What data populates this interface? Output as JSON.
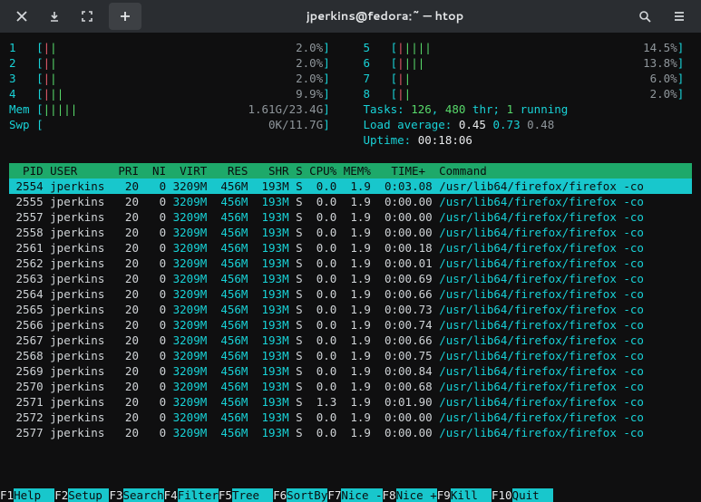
{
  "window": {
    "title": "jperkins@fedora:~ — htop"
  },
  "cpu_meters_left": [
    {
      "n": "1",
      "bars": "||",
      "pct": "2.0%"
    },
    {
      "n": "2",
      "bars": "||",
      "pct": "2.0%"
    },
    {
      "n": "3",
      "bars": "||",
      "pct": "2.0%"
    },
    {
      "n": "4",
      "bars": "|||",
      "pct": "9.9%"
    }
  ],
  "cpu_meters_right": [
    {
      "n": "5",
      "bars": "|||||",
      "pct": "14.5%"
    },
    {
      "n": "6",
      "bars": "||||",
      "pct": "13.8%"
    },
    {
      "n": "7",
      "bars": "||",
      "pct": "6.0%"
    },
    {
      "n": "8",
      "bars": "||",
      "pct": "2.0%"
    }
  ],
  "mem": {
    "label": "Mem",
    "bars": "|||||",
    "text": "1.61G/23.4G"
  },
  "swp": {
    "label": "Swp",
    "bars": "",
    "text": "0K/11.7G"
  },
  "tasks": {
    "prefix": "Tasks:",
    "procs": "126",
    "sep1": ",",
    "thr": "480",
    "thr_lbl": "thr;",
    "running": "1",
    "running_lbl": "running"
  },
  "load": {
    "prefix": "Load average:",
    "a": "0.45",
    "b": "0.73",
    "c": "0.48"
  },
  "uptime": {
    "prefix": "Uptime:",
    "val": "00:18:06"
  },
  "header": "  PID USER      PRI  NI  VIRT   RES   SHR S CPU% MEM%   TIME+  Command",
  "processes": [
    {
      "pid": "2554",
      "user": "jperkins",
      "pri": "20",
      "ni": "0",
      "virt": "3209M",
      "res": "456M",
      "shr": "193M",
      "s": "S",
      "cpu": "0.0",
      "mem": "1.9",
      "time": "0:03.08",
      "cmd": "/usr/lib64/firefox/firefox -co",
      "sel": true
    },
    {
      "pid": "2555",
      "user": "jperkins",
      "pri": "20",
      "ni": "0",
      "virt": "3209M",
      "res": "456M",
      "shr": "193M",
      "s": "S",
      "cpu": "0.0",
      "mem": "1.9",
      "time": "0:00.00",
      "cmd": "/usr/lib64/firefox/firefox -co"
    },
    {
      "pid": "2557",
      "user": "jperkins",
      "pri": "20",
      "ni": "0",
      "virt": "3209M",
      "res": "456M",
      "shr": "193M",
      "s": "S",
      "cpu": "0.0",
      "mem": "1.9",
      "time": "0:00.00",
      "cmd": "/usr/lib64/firefox/firefox -co"
    },
    {
      "pid": "2558",
      "user": "jperkins",
      "pri": "20",
      "ni": "0",
      "virt": "3209M",
      "res": "456M",
      "shr": "193M",
      "s": "S",
      "cpu": "0.0",
      "mem": "1.9",
      "time": "0:00.00",
      "cmd": "/usr/lib64/firefox/firefox -co"
    },
    {
      "pid": "2561",
      "user": "jperkins",
      "pri": "20",
      "ni": "0",
      "virt": "3209M",
      "res": "456M",
      "shr": "193M",
      "s": "S",
      "cpu": "0.0",
      "mem": "1.9",
      "time": "0:00.18",
      "cmd": "/usr/lib64/firefox/firefox -co"
    },
    {
      "pid": "2562",
      "user": "jperkins",
      "pri": "20",
      "ni": "0",
      "virt": "3209M",
      "res": "456M",
      "shr": "193M",
      "s": "S",
      "cpu": "0.0",
      "mem": "1.9",
      "time": "0:00.01",
      "cmd": "/usr/lib64/firefox/firefox -co"
    },
    {
      "pid": "2563",
      "user": "jperkins",
      "pri": "20",
      "ni": "0",
      "virt": "3209M",
      "res": "456M",
      "shr": "193M",
      "s": "S",
      "cpu": "0.0",
      "mem": "1.9",
      "time": "0:00.69",
      "cmd": "/usr/lib64/firefox/firefox -co"
    },
    {
      "pid": "2564",
      "user": "jperkins",
      "pri": "20",
      "ni": "0",
      "virt": "3209M",
      "res": "456M",
      "shr": "193M",
      "s": "S",
      "cpu": "0.0",
      "mem": "1.9",
      "time": "0:00.66",
      "cmd": "/usr/lib64/firefox/firefox -co"
    },
    {
      "pid": "2565",
      "user": "jperkins",
      "pri": "20",
      "ni": "0",
      "virt": "3209M",
      "res": "456M",
      "shr": "193M",
      "s": "S",
      "cpu": "0.0",
      "mem": "1.9",
      "time": "0:00.73",
      "cmd": "/usr/lib64/firefox/firefox -co"
    },
    {
      "pid": "2566",
      "user": "jperkins",
      "pri": "20",
      "ni": "0",
      "virt": "3209M",
      "res": "456M",
      "shr": "193M",
      "s": "S",
      "cpu": "0.0",
      "mem": "1.9",
      "time": "0:00.74",
      "cmd": "/usr/lib64/firefox/firefox -co"
    },
    {
      "pid": "2567",
      "user": "jperkins",
      "pri": "20",
      "ni": "0",
      "virt": "3209M",
      "res": "456M",
      "shr": "193M",
      "s": "S",
      "cpu": "0.0",
      "mem": "1.9",
      "time": "0:00.66",
      "cmd": "/usr/lib64/firefox/firefox -co"
    },
    {
      "pid": "2568",
      "user": "jperkins",
      "pri": "20",
      "ni": "0",
      "virt": "3209M",
      "res": "456M",
      "shr": "193M",
      "s": "S",
      "cpu": "0.0",
      "mem": "1.9",
      "time": "0:00.75",
      "cmd": "/usr/lib64/firefox/firefox -co"
    },
    {
      "pid": "2569",
      "user": "jperkins",
      "pri": "20",
      "ni": "0",
      "virt": "3209M",
      "res": "456M",
      "shr": "193M",
      "s": "S",
      "cpu": "0.0",
      "mem": "1.9",
      "time": "0:00.84",
      "cmd": "/usr/lib64/firefox/firefox -co"
    },
    {
      "pid": "2570",
      "user": "jperkins",
      "pri": "20",
      "ni": "0",
      "virt": "3209M",
      "res": "456M",
      "shr": "193M",
      "s": "S",
      "cpu": "0.0",
      "mem": "1.9",
      "time": "0:00.68",
      "cmd": "/usr/lib64/firefox/firefox -co"
    },
    {
      "pid": "2571",
      "user": "jperkins",
      "pri": "20",
      "ni": "0",
      "virt": "3209M",
      "res": "456M",
      "shr": "193M",
      "s": "S",
      "cpu": "1.3",
      "mem": "1.9",
      "time": "0:01.90",
      "cmd": "/usr/lib64/firefox/firefox -co"
    },
    {
      "pid": "2572",
      "user": "jperkins",
      "pri": "20",
      "ni": "0",
      "virt": "3209M",
      "res": "456M",
      "shr": "193M",
      "s": "S",
      "cpu": "0.0",
      "mem": "1.9",
      "time": "0:00.00",
      "cmd": "/usr/lib64/firefox/firefox -co"
    },
    {
      "pid": "2577",
      "user": "jperkins",
      "pri": "20",
      "ni": "0",
      "virt": "3209M",
      "res": "456M",
      "shr": "193M",
      "s": "S",
      "cpu": "0.0",
      "mem": "1.9",
      "time": "0:00.00",
      "cmd": "/usr/lib64/firefox/firefox -co"
    }
  ],
  "fkeys": [
    {
      "k": "F1",
      "l": "Help  "
    },
    {
      "k": "F2",
      "l": "Setup "
    },
    {
      "k": "F3",
      "l": "Search"
    },
    {
      "k": "F4",
      "l": "Filter"
    },
    {
      "k": "F5",
      "l": "Tree  "
    },
    {
      "k": "F6",
      "l": "SortBy"
    },
    {
      "k": "F7",
      "l": "Nice -"
    },
    {
      "k": "F8",
      "l": "Nice +"
    },
    {
      "k": "F9",
      "l": "Kill  "
    },
    {
      "k": "F10",
      "l": "Quit  "
    }
  ]
}
